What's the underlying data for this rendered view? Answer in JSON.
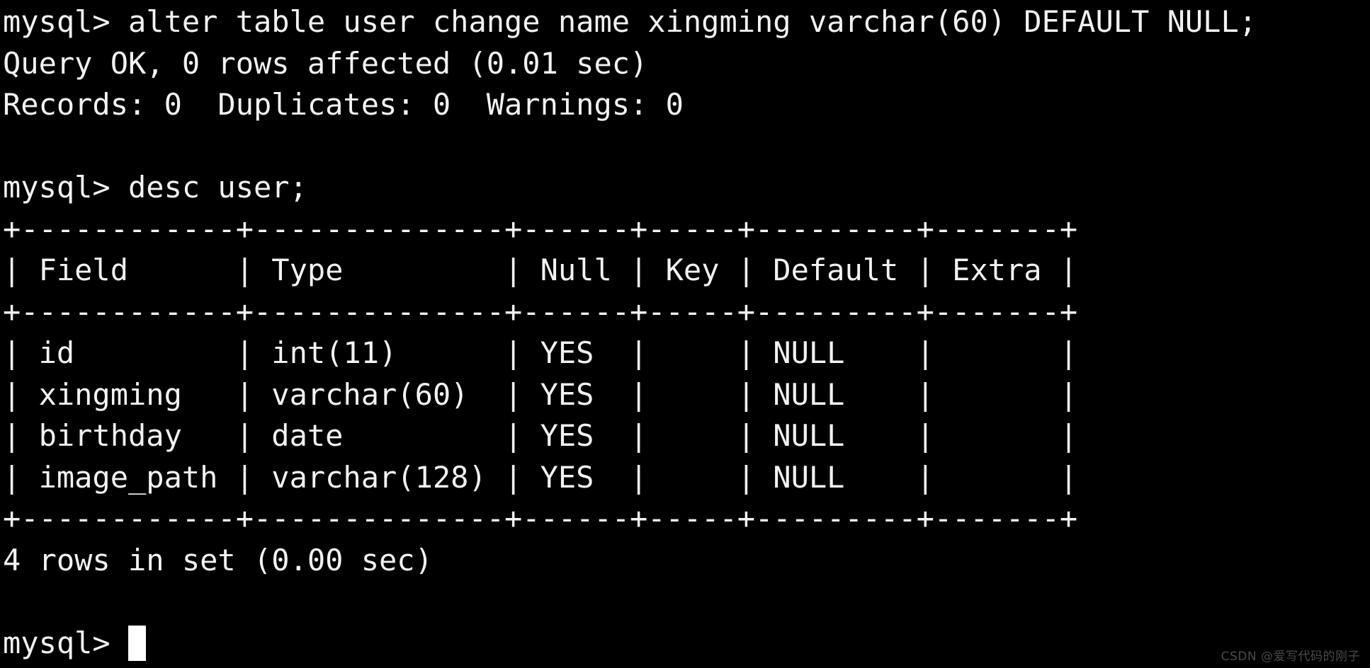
{
  "terminal": {
    "background_color": "#000000",
    "foreground_color": "#f2f2f2",
    "cursor_color": "#ffffff",
    "prompt": "mysql> ",
    "lines": [
      {
        "id": "cmd-alter-table",
        "text": "mysql> alter table user change name xingming varchar(60) DEFAULT NULL;"
      },
      {
        "id": "result-query-ok",
        "text": "Query OK, 0 rows affected (0.01 sec)"
      },
      {
        "id": "result-records",
        "text": "Records: 0  Duplicates: 0  Warnings: 0"
      },
      {
        "id": "blank-1",
        "text": ""
      },
      {
        "id": "cmd-desc-user",
        "text": "mysql> desc user;"
      },
      {
        "id": "table-top-border",
        "text": "+------------+--------------+------+-----+---------+-------+"
      },
      {
        "id": "table-header-row",
        "text": "| Field      | Type         | Null | Key | Default | Extra |"
      },
      {
        "id": "table-header-separator",
        "text": "+------------+--------------+------+-----+---------+-------+"
      },
      {
        "id": "table-row-id",
        "text": "| id         | int(11)      | YES  |     | NULL    |       |"
      },
      {
        "id": "table-row-xingming",
        "text": "| xingming   | varchar(60)  | YES  |     | NULL    |       |"
      },
      {
        "id": "table-row-birthday",
        "text": "| birthday   | date         | YES  |     | NULL    |       |"
      },
      {
        "id": "table-row-image-path",
        "text": "| image_path | varchar(128) | YES  |     | NULL    |       |"
      },
      {
        "id": "table-bottom-border",
        "text": "+------------+--------------+------+-----+---------+-------+"
      },
      {
        "id": "result-rows-in-set",
        "text": "4 rows in set (0.00 sec)"
      },
      {
        "id": "blank-2",
        "text": ""
      }
    ],
    "final_prompt": "mysql> "
  },
  "query_result": {
    "statement": "desc user;",
    "columns": [
      "Field",
      "Type",
      "Null",
      "Key",
      "Default",
      "Extra"
    ],
    "rows": [
      {
        "Field": "id",
        "Type": "int(11)",
        "Null": "YES",
        "Key": "",
        "Default": "NULL",
        "Extra": ""
      },
      {
        "Field": "xingming",
        "Type": "varchar(60)",
        "Null": "YES",
        "Key": "",
        "Default": "NULL",
        "Extra": ""
      },
      {
        "Field": "birthday",
        "Type": "date",
        "Null": "YES",
        "Key": "",
        "Default": "NULL",
        "Extra": ""
      },
      {
        "Field": "image_path",
        "Type": "varchar(128)",
        "Null": "YES",
        "Key": "",
        "Default": "NULL",
        "Extra": ""
      }
    ],
    "row_count_text": "4 rows in set (0.00 sec)",
    "alter_result": {
      "status": "Query OK, 0 rows affected (0.01 sec)",
      "records": "0",
      "duplicates": "0",
      "warnings": "0"
    }
  },
  "watermark": {
    "text": "CSDN @爱写代码的刚子",
    "color": "#4a4a4a"
  }
}
